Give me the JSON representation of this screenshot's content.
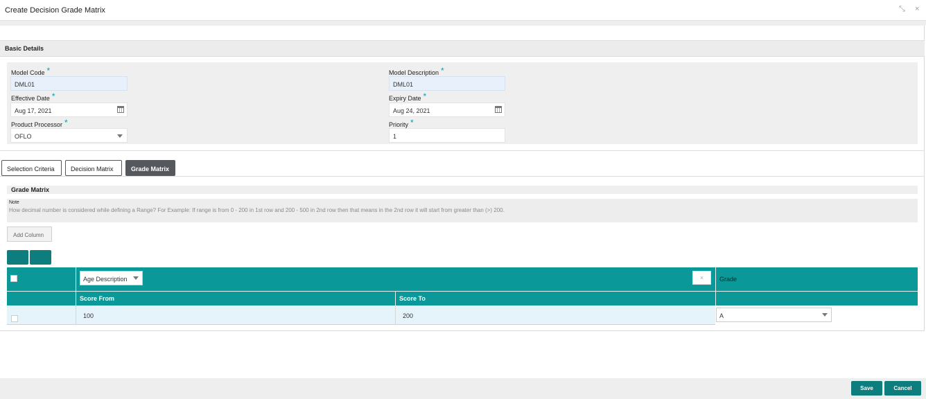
{
  "window": {
    "title": "Create Decision Grade Matrix",
    "restore_glyph": "⤡",
    "close_glyph": "×"
  },
  "basic_details": {
    "header": "Basic Details",
    "model_code": {
      "label": "Model Code",
      "value": "DML01"
    },
    "model_description": {
      "label": "Model Description",
      "value": "DML01"
    },
    "effective_date": {
      "label": "Effective Date",
      "value": "Aug 17, 2021"
    },
    "expiry_date": {
      "label": "Expiry Date",
      "value": "Aug 24, 2021"
    },
    "product_processor": {
      "label": "Product Processor",
      "value": "OFLO"
    },
    "priority": {
      "label": "Priority",
      "value": "1"
    },
    "required_mark": "*"
  },
  "tabs": [
    {
      "label": "Selection Criteria"
    },
    {
      "label": "Decision Matrix"
    },
    {
      "label": "Grade Matrix"
    }
  ],
  "grade_matrix": {
    "header": "Grade Matrix",
    "note_title": "Note",
    "note_text": "How decimal number is considered while defining a Range? For Example: If range is from 0 - 200 in 1st row and 200 - 500 in 2nd row then that means in the 2nd row it will start from greater than (>) 200.",
    "add_column_label": "Add Column",
    "add_row_glyph": "+",
    "remove_row_glyph": "−",
    "column_select": "Age Description",
    "column_remove_glyph": "×",
    "grade_header": "Grade",
    "score_from_header": "Score From",
    "score_to_header": "Score To",
    "rows": [
      {
        "score_from": "100",
        "score_to": "200",
        "grade": "A"
      }
    ]
  },
  "footer": {
    "save_label": "Save",
    "cancel_label": "Cancel"
  }
}
